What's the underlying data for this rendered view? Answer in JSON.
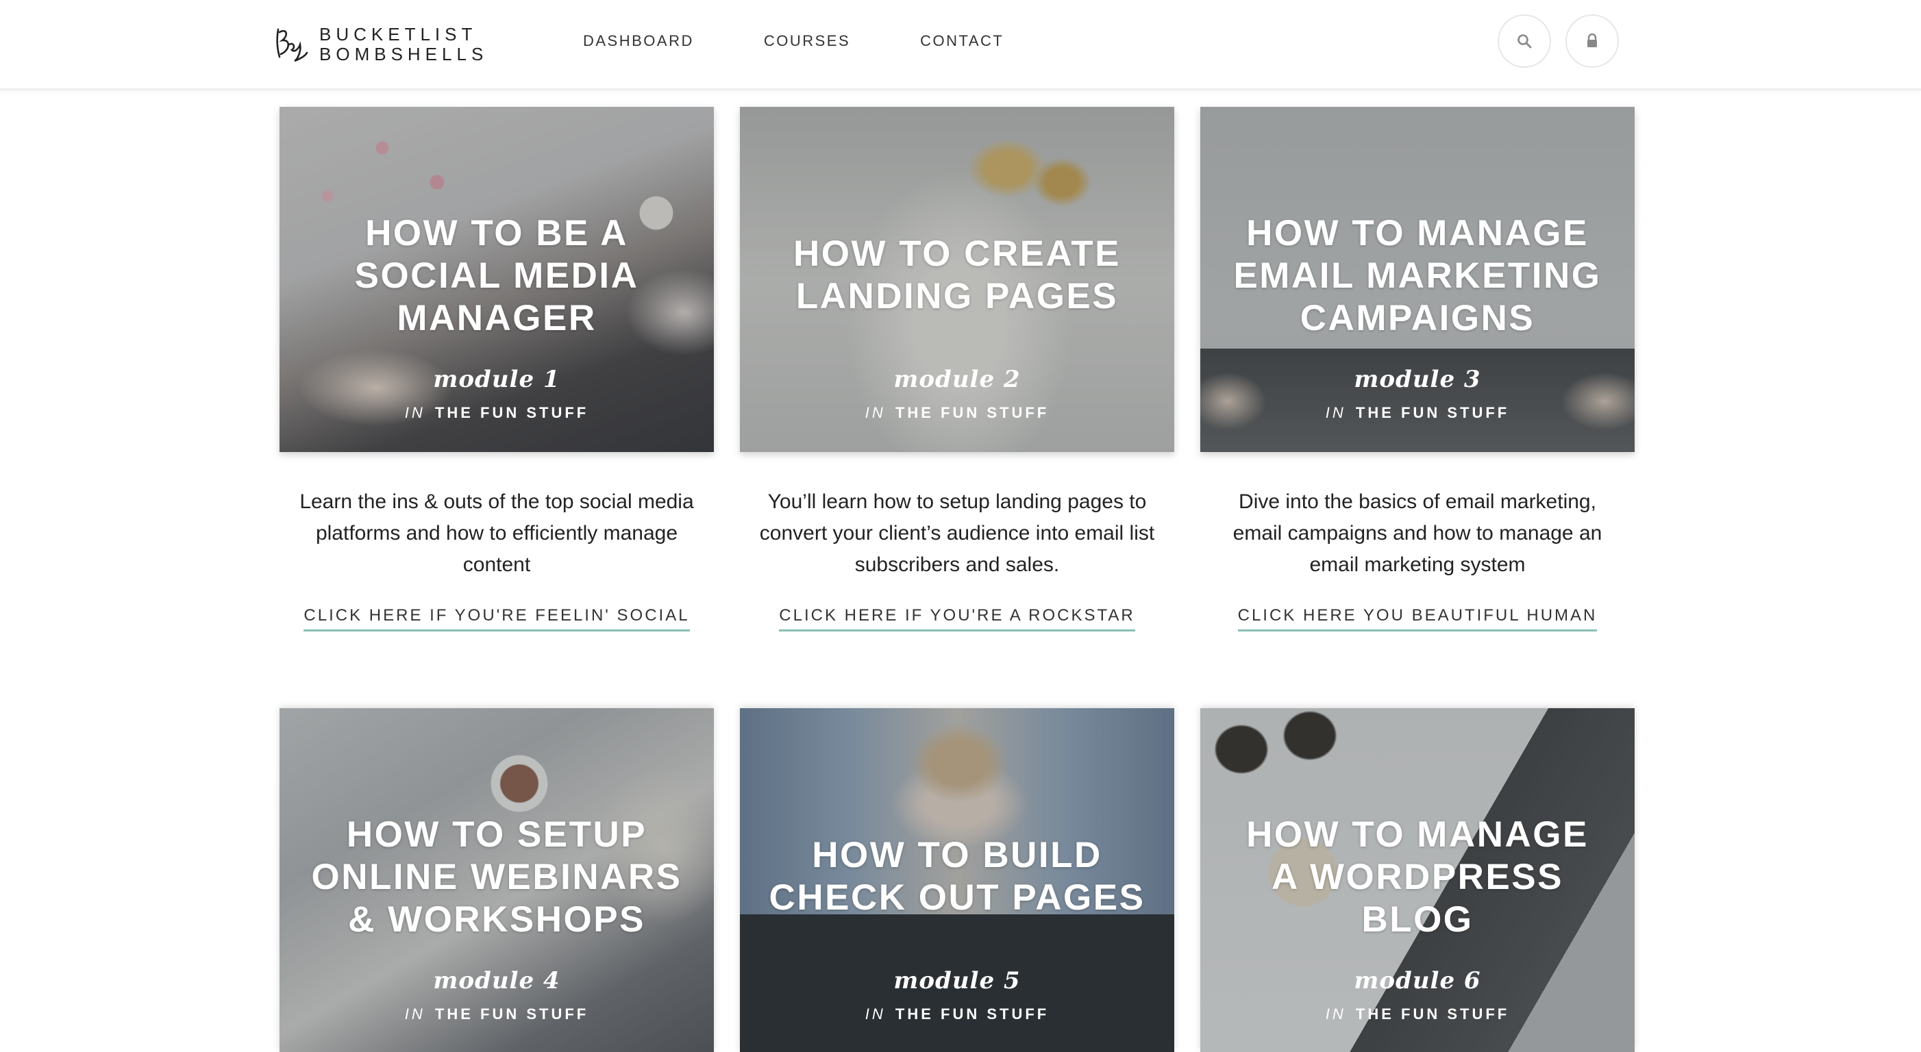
{
  "brand": {
    "line1": "BUCKETLIST",
    "line2": "BOMBSHELLS",
    "accent_color": "#8bbdb6"
  },
  "nav": {
    "items": [
      {
        "label": "DASHBOARD"
      },
      {
        "label": "COURSES"
      },
      {
        "label": "CONTACT"
      }
    ],
    "search_icon": "search-icon",
    "lock_icon": "lock-icon"
  },
  "modules": [
    {
      "title_lines": [
        "HOW TO BE A",
        "SOCIAL MEDIA",
        "MANAGER"
      ],
      "module_label": "module 1",
      "category_prefix": "IN",
      "category": "THE FUN STUFF",
      "description": "Learn the ins & outs of the top social media platforms and how to efficiently manage content",
      "cta": "CLICK HERE IF YOU'RE FEELIN' SOCIAL"
    },
    {
      "title_lines": [
        "HOW TO CREATE",
        "LANDING PAGES"
      ],
      "module_label": "module 2",
      "category_prefix": "IN",
      "category": "THE FUN STUFF",
      "description": "You’ll learn how to setup landing pages to convert your client’s audience into email list subscribers and sales.",
      "cta": "CLICK HERE IF YOU'RE A ROCKSTAR"
    },
    {
      "title_lines": [
        "HOW TO MANAGE",
        "EMAIL MARKETING",
        "CAMPAIGNS"
      ],
      "module_label": "module 3",
      "category_prefix": "IN",
      "category": "THE FUN STUFF",
      "description": "Dive into the basics of email marketing, email campaigns and how to manage an email marketing system",
      "cta": "CLICK HERE YOU BEAUTIFUL HUMAN"
    },
    {
      "title_lines": [
        "HOW TO SETUP",
        "ONLINE WEBINARS",
        "& WORKSHOPS"
      ],
      "module_label": "module 4",
      "category_prefix": "IN",
      "category": "THE FUN STUFF"
    },
    {
      "title_lines": [
        "HOW TO BUILD",
        "CHECK OUT PAGES"
      ],
      "module_label": "module 5",
      "category_prefix": "IN",
      "category": "THE FUN STUFF"
    },
    {
      "title_lines": [
        "HOW TO MANAGE",
        "A WORDPRESS",
        "BLOG"
      ],
      "module_label": "module 6",
      "category_prefix": "IN",
      "category": "THE FUN STUFF"
    }
  ]
}
